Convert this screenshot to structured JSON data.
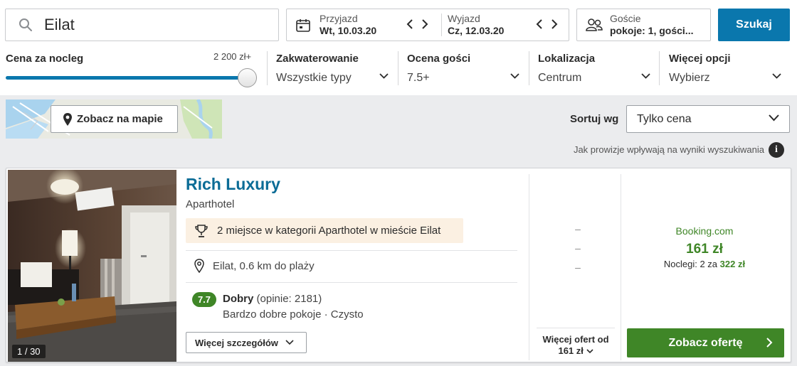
{
  "search": {
    "destination": "Eilat",
    "search_icon": "search-icon"
  },
  "dates": {
    "checkin_label": "Przyjazd",
    "checkin_value": "Wt, 10.03.20",
    "checkout_label": "Wyjazd",
    "checkout_value": "Cz, 12.03.20"
  },
  "guests": {
    "label": "Goście",
    "value": "pokoje: 1, gości..."
  },
  "search_button": "Szukaj",
  "filters": {
    "price_label": "Cena za nocleg",
    "price_value": "2 200 zł+",
    "price_slider_position_percent": 100,
    "items": [
      {
        "label": "Zakwaterowanie",
        "value": "Wszystkie typy"
      },
      {
        "label": "Ocena gości",
        "value": "7.5+"
      },
      {
        "label": "Lokalizacja",
        "value": "Centrum"
      },
      {
        "label": "Więcej opcji",
        "value": "Wybierz"
      }
    ]
  },
  "map_button": "Zobacz na mapie",
  "sort": {
    "label": "Sortuj wg",
    "value": "Tylko cena"
  },
  "provision_note": "Jak prowizje wpływają na wyniki wyszukiwania",
  "info_symbol": "i",
  "result": {
    "photo_count": "1 / 30",
    "name": "Rich Luxury",
    "type": "Aparthotel",
    "award": "2 miejsce w kategorii Aparthotel w mieście Eilat",
    "location": "Eilat, 0.6 km do plaży",
    "rating_score": "7.7",
    "rating_word": "Dobry",
    "rating_count": "(opinie: 2181)",
    "rating_highlights": "Bardzo dobre pokoje · Czysto",
    "details_button": "Więcej szczegółów",
    "dashes": [
      "–",
      "–",
      "–"
    ],
    "more_offers_line1": "Więcej ofert od",
    "more_offers_line2": "161 zł",
    "provider": "Booking.com",
    "price": "161 zł",
    "nights_prefix": "Noclegi: 2 za",
    "nights_total": "322 zł",
    "offer_button": "Zobacz ofertę"
  },
  "colors": {
    "primary_blue": "#0a77ad",
    "offer_green": "#3f8627",
    "award_bg": "#fbf0e2"
  }
}
